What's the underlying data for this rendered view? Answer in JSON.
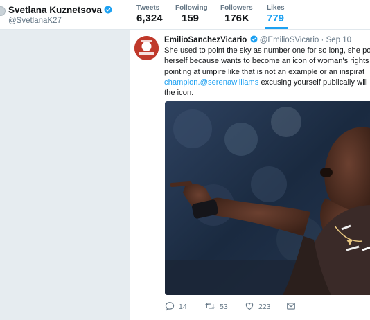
{
  "profile": {
    "name": "Svetlana Kuznetsova",
    "handle": "@SvetlanaK27"
  },
  "stats": [
    {
      "label": "Tweets",
      "value": "6,324"
    },
    {
      "label": "Following",
      "value": "159"
    },
    {
      "label": "Followers",
      "value": "176K"
    },
    {
      "label": "Likes",
      "value": "779"
    }
  ],
  "tweet": {
    "author": "EmilioSanchezVicario",
    "handle": "@EmilioSVicario",
    "time": "Sep 10",
    "line1": "She used to point the sky as number one for so long, she po",
    "line2": "herself because wants to become an icon of woman's rights",
    "line3": "pointing at umpire like that is not an example or an inspirat",
    "line4_mention": "champion.@serenawilliams",
    "line4_rest": " excusing yourself publically will",
    "line5": "the icon.",
    "replies": "14",
    "retweets": "53",
    "likes": "223"
  },
  "colors": {
    "accent": "#1da1f2",
    "background": "#e6ecf0",
    "secondary_text": "#657786"
  },
  "icons": [
    "verified-badge-icon",
    "reply-icon",
    "retweet-icon",
    "like-icon",
    "message-icon"
  ]
}
